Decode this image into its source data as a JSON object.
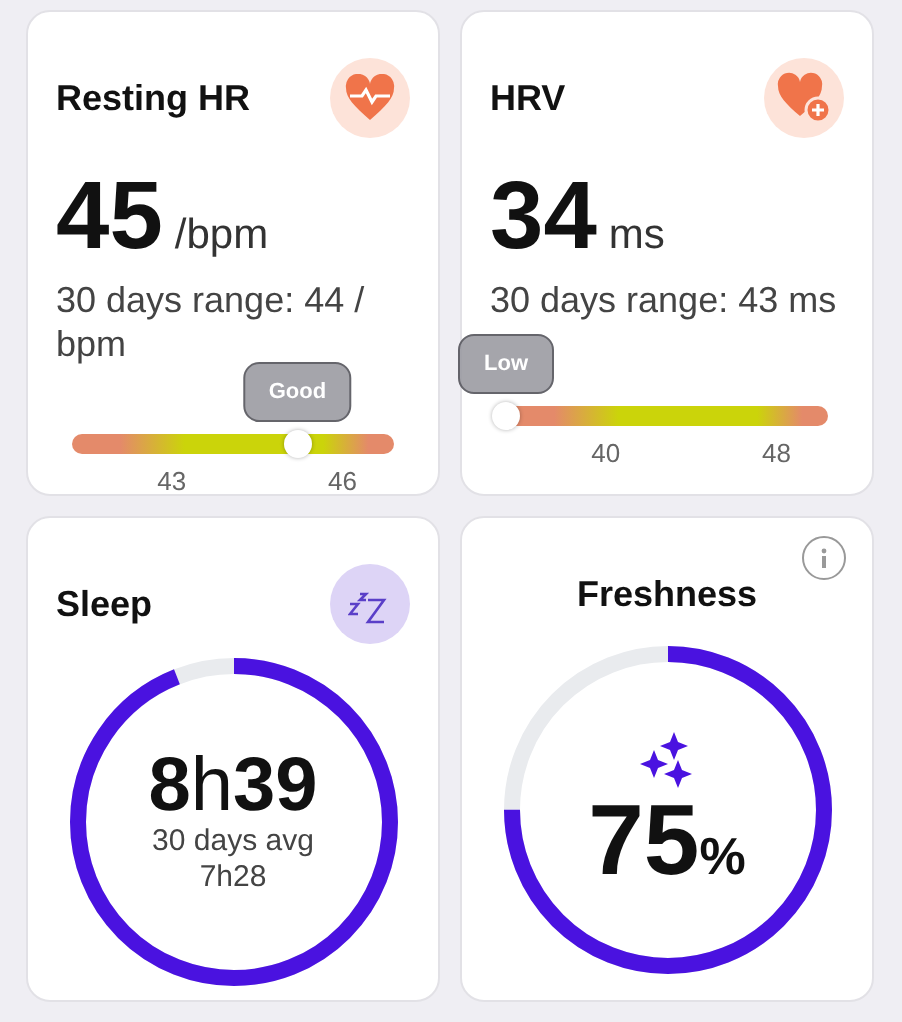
{
  "metrics": [
    {
      "kind": "gauge",
      "title": "Resting HR",
      "value": "45",
      "unit": "/bpm",
      "range": "30 days range: 44 / bpm",
      "tooltip": "Good",
      "level": 0.7,
      "ticks": [
        "43",
        "46"
      ]
    },
    {
      "kind": "gauge",
      "title": "HRV",
      "value": "34",
      "unit": "ms",
      "range": "30 days range: 43 ms",
      "tooltip": "Low",
      "level": 0,
      "ticks": [
        "40",
        "48"
      ]
    },
    {
      "kind": "ring",
      "title": "Sleep",
      "value": "**8**h**39**",
      "caption": "30 days avg",
      "sub": "7h28"
    },
    {
      "kind": "ring",
      "title": "Freshness",
      "value": "75",
      "unit": "%"
    }
  ]
}
